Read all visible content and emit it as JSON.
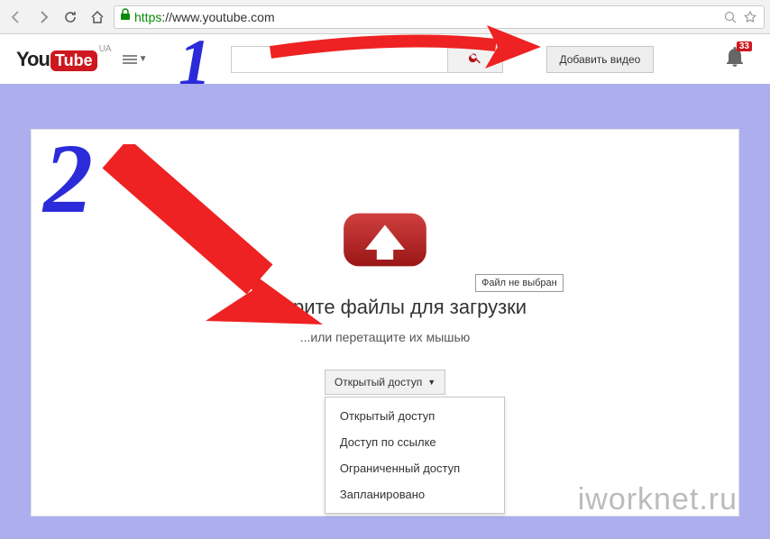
{
  "browser": {
    "url_https": "https",
    "url_rest": "://www.youtube.com"
  },
  "header": {
    "logo_you": "You",
    "logo_tube": "Tube",
    "region": "UA",
    "search_placeholder": "",
    "add_video_label": "Добавить видео",
    "notification_count": "33"
  },
  "upload": {
    "tooltip": "Файл не выбран",
    "title": "Выберите файлы для загрузки",
    "subtitle": "...или перетащите их мышью",
    "privacy_selected": "Открытый доступ",
    "privacy_options": [
      "Открытый доступ",
      "Доступ по ссылке",
      "Ограниченный доступ",
      "Запланировано"
    ]
  },
  "annotations": {
    "one": "1",
    "two": "2",
    "watermark": "iworknet.ru"
  }
}
